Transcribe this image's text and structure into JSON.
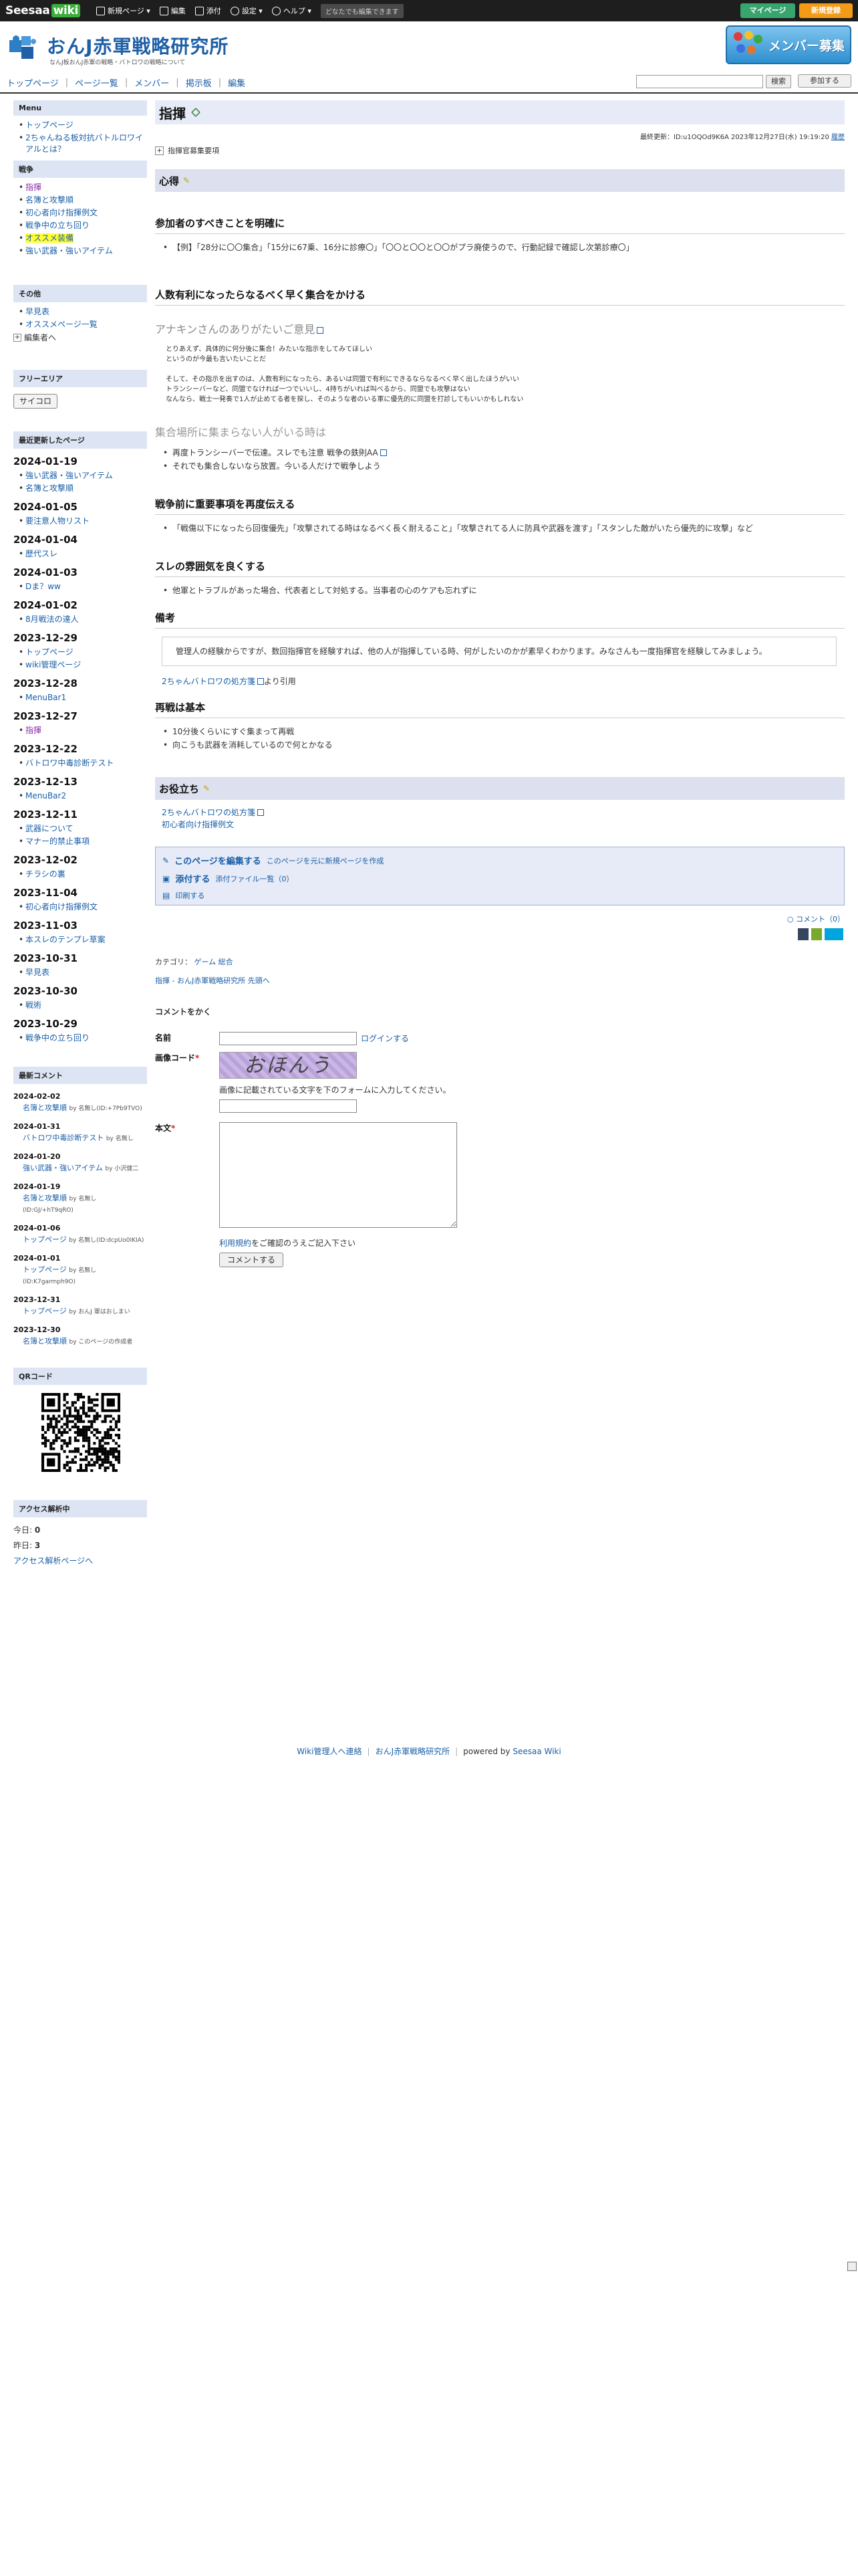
{
  "topbar": {
    "logo_text": "Seesaa",
    "logo_badge": "wiki",
    "items": [
      "新規ページ ▾",
      "編集",
      "添付",
      "設定 ▾",
      "ヘルプ ▾"
    ],
    "note": "どなたでも編集できます",
    "mypage": "マイページ",
    "register": "新規登録"
  },
  "header": {
    "title": "おんJ赤軍戦略研究所",
    "subtitle": "なんJ板おんJ赤軍の戦略・バトロワの戦略について",
    "banner": "メンバー募集"
  },
  "nav": {
    "items": [
      "トップページ",
      "ページ一覧",
      "メンバー",
      "掲示板",
      "編集"
    ],
    "search_button": "検索",
    "join_button": "参加する"
  },
  "sidebar": {
    "menu_title": "Menu",
    "menu_items": [
      "トップページ",
      "2ちゃんねる板対抗バトルロワイアルとは？"
    ],
    "war_title": "戦争",
    "war_items": [
      "指揮",
      "名簿と攻撃順",
      "初心者向け指揮例文",
      "戦争中の立ち回り",
      "オススメ装備",
      "強い武器・強いアイテム"
    ],
    "other_title": "その他",
    "other_items": [
      "早見表",
      "オススメページ一覧"
    ],
    "editor_label": "編集者へ",
    "free_title": "フリーエリア",
    "dice_button": "サイコロ",
    "recent_title": "最近更新したページ",
    "recent": [
      {
        "date": "2024-01-19",
        "items": [
          "強い武器・強いアイテム",
          "名簿と攻撃順"
        ]
      },
      {
        "date": "2024-01-05",
        "items": [
          "要注意人物リスト"
        ]
      },
      {
        "date": "2024-01-04",
        "items": [
          "歴代スレ"
        ]
      },
      {
        "date": "2024-01-03",
        "items": [
          "Dま？ww"
        ]
      },
      {
        "date": "2024-01-02",
        "items": [
          "8月戦法の達人"
        ]
      },
      {
        "date": "2023-12-29",
        "items": [
          "トップページ",
          "wiki管理ページ"
        ]
      },
      {
        "date": "2023-12-28",
        "items": [
          "MenuBar1"
        ]
      },
      {
        "date": "2023-12-27",
        "items": [
          "指揮"
        ]
      },
      {
        "date": "2023-12-22",
        "items": [
          "バトロワ中毒診断テスト"
        ]
      },
      {
        "date": "2023-12-13",
        "items": [
          "MenuBar2"
        ]
      },
      {
        "date": "2023-12-11",
        "items": [
          "武器について",
          "マナー的禁止事項"
        ]
      },
      {
        "date": "2023-12-02",
        "items": [
          "チラシの裏"
        ]
      },
      {
        "date": "2023-11-04",
        "items": [
          "初心者向け指揮例文"
        ]
      },
      {
        "date": "2023-11-03",
        "items": [
          "本スレのテンプレ草案"
        ]
      },
      {
        "date": "2023-10-31",
        "items": [
          "早見表"
        ]
      },
      {
        "date": "2023-10-30",
        "items": [
          "戦術"
        ]
      },
      {
        "date": "2023-10-29",
        "items": [
          "戦争中の立ち回り"
        ]
      }
    ],
    "comments_title": "最新コメント",
    "comments": [
      {
        "date": "2024-02-02",
        "page": "名簿と攻撃順",
        "by": "by 名無し(ID:+7Pb9TVO)"
      },
      {
        "date": "2024-01-31",
        "page": "バトロワ中毒診断テスト",
        "by": "by 名無し"
      },
      {
        "date": "2024-01-20",
        "page": "強い武器・強いアイテム",
        "by": "by 小沢健二"
      },
      {
        "date": "2024-01-19",
        "page": "名簿と攻撃順",
        "by": "by 名無し(ID:GJ/+hT9qRO)"
      },
      {
        "date": "2024-01-06",
        "page": "トップページ",
        "by": "by 名無し(ID:dcpUo0IKIA)"
      },
      {
        "date": "2024-01-01",
        "page": "トップページ",
        "by": "by 名無し(ID:K7garmph9O)"
      },
      {
        "date": "2023-12-31",
        "page": "トップページ",
        "by": "by おんJ 軍はおしまい"
      },
      {
        "date": "2023-12-30",
        "page": "名簿と攻撃順",
        "by": "by このページの作成者"
      }
    ],
    "qr_title": "QRコード",
    "access_title": "アクセス解析中",
    "today_label": "今日:",
    "today_value": "0",
    "yesterday_label": "昨日:",
    "yesterday_value": "3",
    "access_link": "アクセス解析ページへ"
  },
  "main": {
    "title": "指揮",
    "updated": "最終更新：ID:u1OQOd9K6A 2023年12月27日(水) 19:19:20",
    "history": "履歴",
    "toc": "指揮官募集要項",
    "s1_title": "心得",
    "h_duty": "参加者のすべきことを明確に",
    "duty_items": [
      "【例】「28分に〇〇集合」「15分に67乗、16分に診療〇」「〇〇と〇〇と〇〇がプラ廃使うので、行動記録で確認し次第診療〇」"
    ],
    "h_gather": "人数有利になったらなるべく早く集合をかける",
    "quote_title": "アナキンさんのありがたいご意見",
    "quote_lines": [
      "とりあえず、具体的に何分後に集合！みたいな指示をしてみてほしい",
      "というのが今最も言いたいことだ",
      "",
      "そして、その指示を出すのは、人数有利になったら、あるいは同盟で有利にできるならなるべく早く出したほうがいい",
      "トランシーバーなど、同盟でなければ一つでいいし、4持ちがいれば叫べるから、同盟でも攻撃はない",
      "なんなら、戦士一発奏で1人が止めてる者を探し、そのような者のいる軍に優先的に同盟を打診してもいいかもしれない"
    ],
    "h_nogather": "集合場所に集まらない人がいる時は",
    "nogather_items": [
      "再度トランシーバーで伝達。スレでも注意 戦争の鉄則AA",
      "それでも集合しないなら放置。今いる人だけで戦争しよう"
    ],
    "h_before": "戦争前に重要事項を再度伝える",
    "before_items": [
      "「戦傷以下になったら回復優先」「攻撃されてる時はなるべく長く耐えること」「攻撃されてる人に防具や武器を渡す」「スタンした敵がいたら優先的に攻撃」など"
    ],
    "h_mood": "スレの雰囲気を良くする",
    "mood_items": [
      "他軍とトラブルがあった場合、代表者として対処する。当事者の心のケアも忘れずに"
    ],
    "h_note": "備考",
    "note_text": "管理人の経験からですが、数回指揮官を経験すれば、他の人が指揮している時、何がしたいのかが素早くわかります。みなさんも一度指揮官を経験してみましょう。",
    "cite_link": "2ちゃんバトロワの処方箋",
    "cite_suffix": "より引用",
    "h_rebuild": "再戦は基本",
    "rebuild_items": [
      "10分後くらいにすぐ集まって再戦",
      "向こうも武器を消耗しているので何とかなる"
    ],
    "s2_title": "お役立ち",
    "useful_links": [
      "2ちゃんバトロワの処方箋",
      "初心者向け指揮例文"
    ],
    "edit_label": "このページを編集する",
    "edit_new": "このページを元に新規ページを作成",
    "attach_label": "添付する",
    "attach_list": "添付ファイル一覧（0）",
    "print_label": "印刷する",
    "comment_count": "コメント（0）",
    "category_label": "カテゴリ：",
    "categories": [
      "ゲーム",
      "総合"
    ],
    "breadcrumb": "指揮 - おんJ赤軍戦略研究所 先頭へ",
    "comment_heading": "コメントをかく",
    "name_label": "名前",
    "login_link": "ログインする",
    "captcha_label": "画像コード",
    "captcha_text": "おほんう",
    "captcha_hint": "画像に記載されている文字を下のフォームに入力してください。",
    "body_label": "本文",
    "terms_link": "利用規約",
    "terms_suffix": "をご確認のうえご記入下さい",
    "submit_button": "コメントする"
  },
  "footer": {
    "admin_link": "Wiki管理人へ連絡",
    "site_link": "おんJ赤軍戦略研究所",
    "powered": "powered by",
    "powered_link": "Seesaa Wiki"
  }
}
